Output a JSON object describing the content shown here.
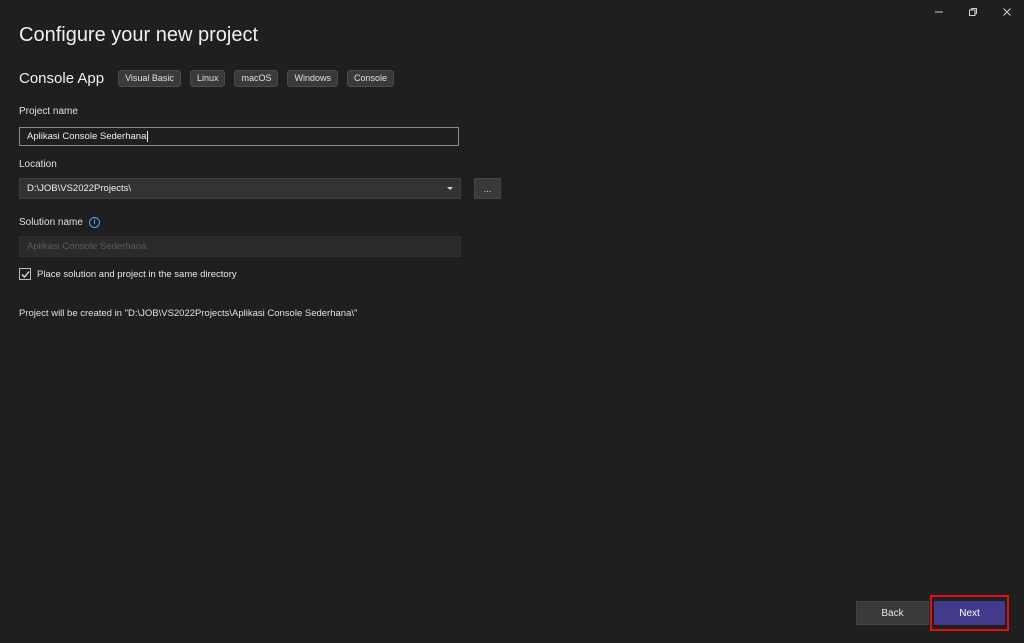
{
  "window_controls": {
    "minimize_icon": "minimize-icon",
    "restore_icon": "restore-icon",
    "close_icon": "close-icon"
  },
  "page": {
    "title": "Configure your new project"
  },
  "template": {
    "name": "Console App",
    "tags": [
      "Visual Basic",
      "Linux",
      "macOS",
      "Windows",
      "Console"
    ]
  },
  "project_name": {
    "label": "Project name",
    "value": "Aplikasi Console Sederhana"
  },
  "location": {
    "label": "Location",
    "value": "D:\\JOB\\VS2022Projects\\",
    "browse_label": "..."
  },
  "solution_name": {
    "label": "Solution name",
    "placeholder": "Aplikasi Console Sederhana",
    "info_icon": "info-icon"
  },
  "same_directory": {
    "label": "Place solution and project in the same directory",
    "checked": true
  },
  "created_message": "Project will be created in \"D:\\JOB\\VS2022Projects\\Aplikasi Console Sederhana\\\"",
  "footer": {
    "back_label": "Back",
    "next_label": "Next"
  },
  "colors": {
    "background": "#1f1f1f",
    "accent": "#443a8c",
    "highlight": "#e01010",
    "info": "#4aa3ff"
  }
}
